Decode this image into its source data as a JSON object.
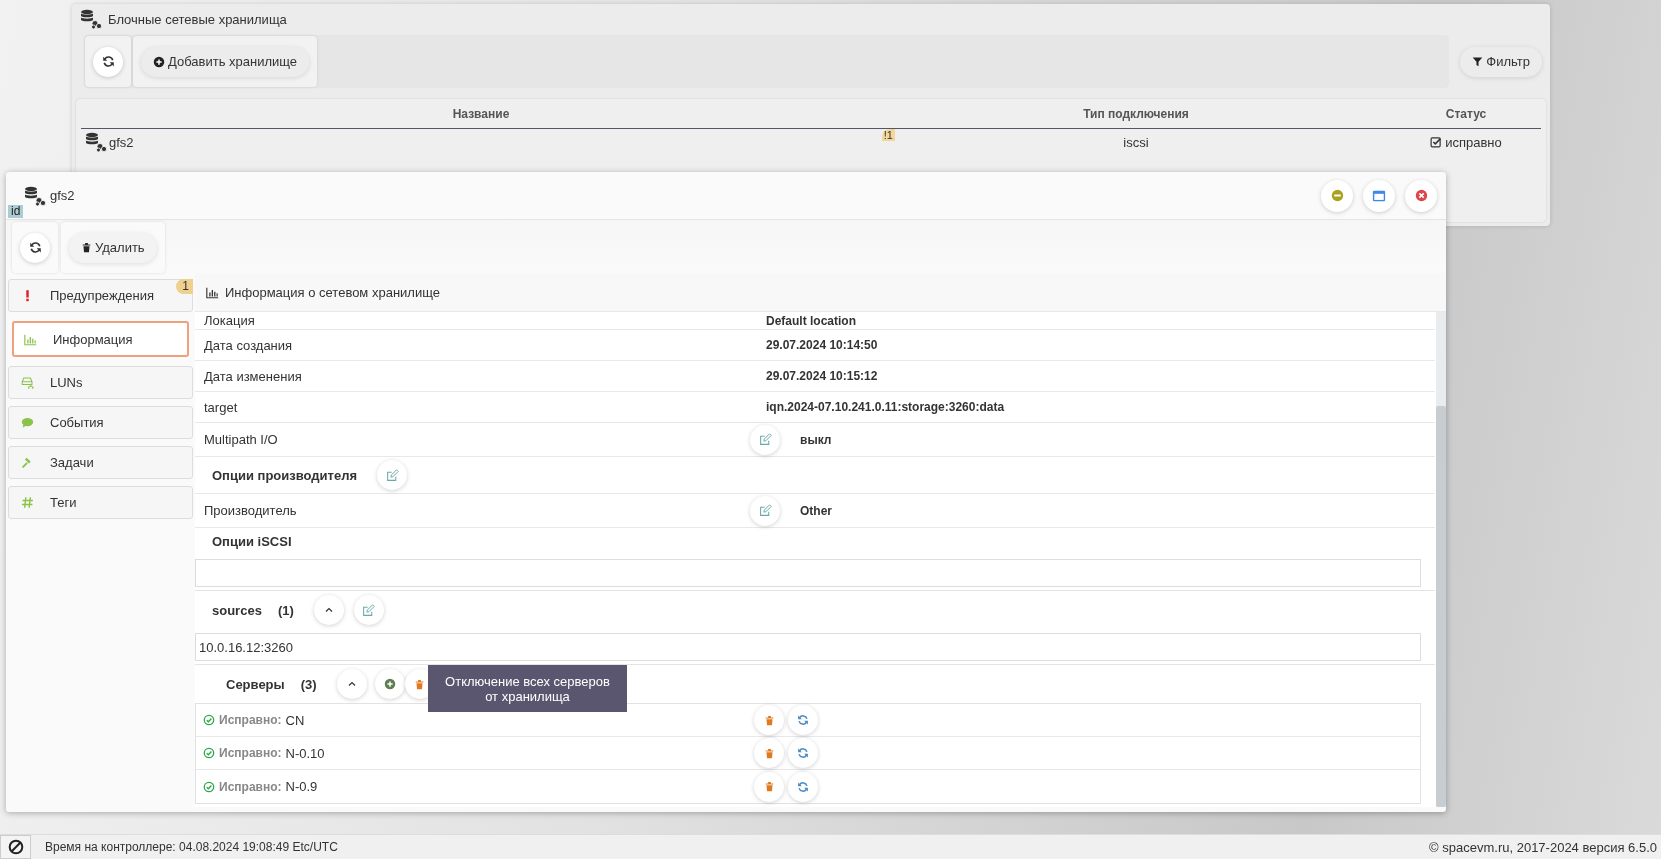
{
  "back_window": {
    "title": "Блочные сетевые хранилища",
    "toolbar": {
      "add_button": "Добавить хранилище",
      "filter_button": "Фильтр"
    },
    "table": {
      "columns": [
        "Название",
        "Тип подключения",
        "Статус"
      ],
      "rows": [
        {
          "name": "gfs2",
          "warnings": "!1",
          "connection_type": "iscsi",
          "status": "исправно"
        }
      ]
    }
  },
  "front_window": {
    "title": "gfs2",
    "id_tag": "id",
    "toolbar": {
      "delete_button": "Удалить"
    },
    "sidebar": {
      "items": [
        {
          "kind": "warning",
          "label": "Предупреждения",
          "badge": "1",
          "selected": false
        },
        {
          "kind": "info",
          "label": "Информация",
          "selected": true
        },
        {
          "kind": "luns",
          "label": "LUNs",
          "selected": false
        },
        {
          "kind": "events",
          "label": "События",
          "selected": false
        },
        {
          "kind": "tasks",
          "label": "Задачи",
          "selected": false
        },
        {
          "kind": "tags",
          "label": "Теги",
          "selected": false
        }
      ]
    },
    "content": {
      "title": "Информация о сетевом хранилище",
      "rows": [
        {
          "label": "Локация",
          "value": "Default location",
          "editable": false
        },
        {
          "label": "Дата создания",
          "value": "29.07.2024 10:14:50",
          "editable": false
        },
        {
          "label": "Дата изменения",
          "value": "29.07.2024 10:15:12",
          "editable": false
        },
        {
          "label": "target",
          "value": "iqn.2024-07.10.241.0.11:storage:3260:data",
          "editable": false
        },
        {
          "label": "Multipath I/O",
          "value": "выкл",
          "editable": true
        }
      ],
      "vendor_options": {
        "title": "Опции производителя",
        "rows": [
          {
            "label": "Производитель",
            "value": "Other",
            "editable": true
          }
        ]
      },
      "iscsi_options": {
        "title": "Опции iSCSI"
      },
      "sources": {
        "title": "sources",
        "count": "(1)",
        "items": [
          "10.0.16.12:3260"
        ]
      },
      "servers": {
        "title": "Серверы",
        "count": "(3)",
        "items": [
          {
            "status": "Исправно:",
            "name": "CN"
          },
          {
            "status": "Исправно:",
            "name": "N-0.10"
          },
          {
            "status": "Исправно:",
            "name": "N-0.9"
          }
        ],
        "tooltip": "Отключение всех серверов от хранилища"
      }
    }
  },
  "status_bar": {
    "controller_time": "Время на контроллере: 04.08.2024 19:08:49 Etc/UTC",
    "copyright": "© spacevm.ru, 2017-2024 версия 6.5.0"
  }
}
